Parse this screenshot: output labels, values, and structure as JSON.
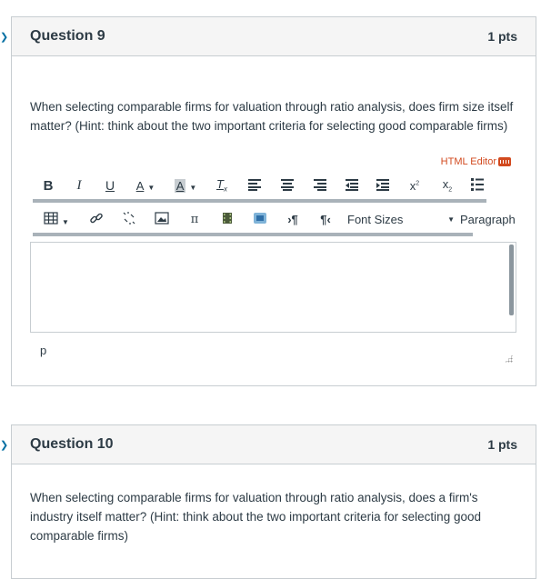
{
  "question9": {
    "title": "Question 9",
    "points": "1 pts",
    "text": "When selecting comparable firms for valuation through ratio analysis, does firm size itself matter? (Hint: think about the two important criteria for selecting good comparable firms)"
  },
  "editor": {
    "html_editor_label": "HTML Editor",
    "toolbar1": [
      {
        "name": "bold-button",
        "label": "B",
        "icon": "bold-icon"
      },
      {
        "name": "italic-button",
        "label": "I",
        "icon": "italic-icon"
      },
      {
        "name": "underline-button",
        "label": "U",
        "icon": "underline-icon"
      },
      {
        "name": "text-color-button",
        "label": "A",
        "icon": "text-color-icon"
      },
      {
        "name": "background-color-button",
        "label": "A",
        "icon": "background-color-icon"
      },
      {
        "name": "clear-formatting-button",
        "label": "Tx",
        "icon": "clear-formatting-icon"
      },
      {
        "name": "align-left-button",
        "label": "",
        "icon": "align-left-icon"
      },
      {
        "name": "align-center-button",
        "label": "",
        "icon": "align-center-icon"
      },
      {
        "name": "align-right-button",
        "label": "",
        "icon": "align-right-icon"
      },
      {
        "name": "outdent-button",
        "label": "",
        "icon": "outdent-icon"
      },
      {
        "name": "indent-button",
        "label": "",
        "icon": "indent-icon"
      },
      {
        "name": "superscript-button",
        "label": "x²",
        "icon": "superscript-icon"
      },
      {
        "name": "subscript-button",
        "label": "x₂",
        "icon": "subscript-icon"
      },
      {
        "name": "bullet-list-button",
        "label": "",
        "icon": "bullet-list-icon"
      }
    ],
    "toolbar2": [
      {
        "name": "table-button",
        "icon": "table-icon"
      },
      {
        "name": "link-button",
        "icon": "link-icon"
      },
      {
        "name": "unlink-button",
        "icon": "unlink-icon"
      },
      {
        "name": "image-button",
        "icon": "image-icon"
      },
      {
        "name": "math-button",
        "icon": "pi-icon"
      },
      {
        "name": "media-button",
        "icon": "film-icon"
      },
      {
        "name": "embed-button",
        "icon": "embed-icon"
      },
      {
        "name": "ltr-button",
        "icon": "paragraph-ltr-icon"
      },
      {
        "name": "rtl-button",
        "icon": "paragraph-rtl-icon"
      }
    ],
    "font_sizes_label": "Font Sizes",
    "paragraph_label": "Paragraph",
    "path_label": "p"
  },
  "question10": {
    "title": "Question 10",
    "points": "1 pts",
    "text": "When selecting comparable firms for valuation through ratio analysis, does a firm's industry itself matter? (Hint: think about the two important criteria for selecting good comparable firms)"
  },
  "colors": {
    "accent": "#d24a1f",
    "link": "#0770a3",
    "text": "#2d3b45",
    "border": "#c7cdd1"
  }
}
